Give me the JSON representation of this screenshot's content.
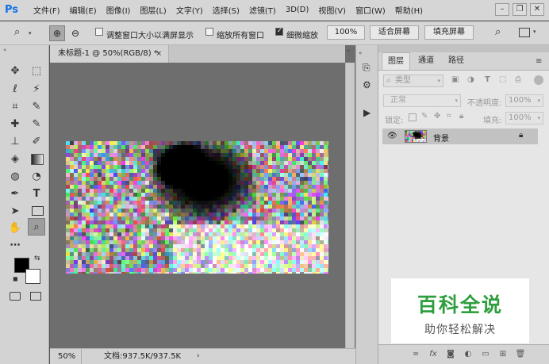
{
  "app": {
    "logo": "Ps"
  },
  "menu": [
    "文件(F)",
    "编辑(E)",
    "图像(I)",
    "图层(L)",
    "文字(Y)",
    "选择(S)",
    "滤镜(T)",
    "3D(D)",
    "视图(V)",
    "窗口(W)",
    "帮助(H)"
  ],
  "window_controls": {
    "minimize": "–",
    "restore": "❐",
    "close": "✕"
  },
  "options": {
    "resize_window": "调整窗口大小以满屏显示",
    "zoom_all": "缩放所有窗口",
    "scrubby_zoom": "细微缩放",
    "zoom_percent": "100%",
    "fit_screen": "适合屏幕",
    "fill_screen": "填充屏幕"
  },
  "document": {
    "tab_title": "未标题-1 @ 50%(RGB/8) *",
    "zoom": "50%",
    "doc_size": "文档:937.5K/937.5K"
  },
  "layers_panel": {
    "tabs": [
      "图层",
      "通道",
      "路径"
    ],
    "filter_kind": "类型",
    "blend_mode": "正常",
    "opacity_label": "不透明度:",
    "opacity_value": "100%",
    "lock_label": "锁定:",
    "fill_label": "填充:",
    "fill_value": "100%",
    "layer_name": "背景"
  },
  "watermark": {
    "title": "百科全说",
    "subtitle": "助你轻松解决",
    "title_color": "#2e9e3e"
  },
  "colors": {
    "foreground": "#000000",
    "background": "#ffffff"
  }
}
